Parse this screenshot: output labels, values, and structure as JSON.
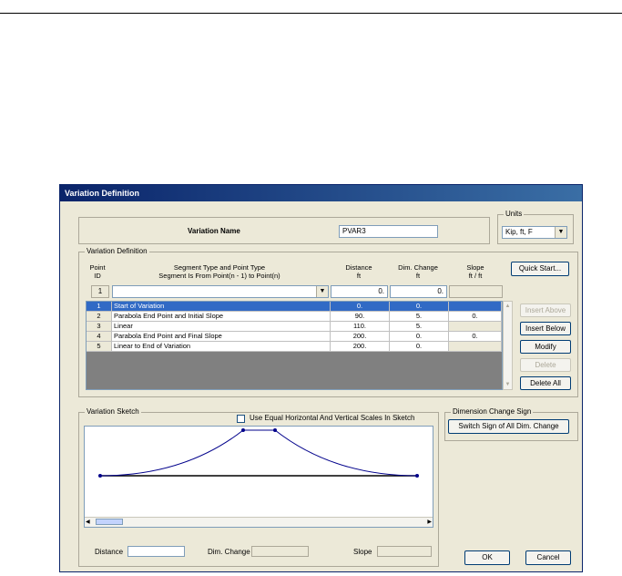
{
  "window": {
    "title": "Variation Definition"
  },
  "variation_name": {
    "label": "Variation Name",
    "value": "PVAR3"
  },
  "units": {
    "legend": "Units",
    "value": "Kip, ft, F"
  },
  "definition": {
    "legend": "Variation Definition",
    "headers": {
      "point": "Point",
      "id": "ID",
      "segment_type": "Segment Type and Point Type",
      "segment_from": "Segment Is From Point(n - 1) to Point(n)",
      "distance": "Distance",
      "distance_unit": "ft",
      "dim_change": "Dim. Change",
      "dim_change_unit": "ft",
      "slope": "Slope",
      "slope_unit": "ft / ft"
    },
    "edit_row": {
      "id": "1",
      "segment": "",
      "distance": "0.",
      "dim_change": "0.",
      "slope": ""
    },
    "rows": [
      {
        "id": "1",
        "segment": "Start of Variation",
        "distance": "0.",
        "dim_change": "0.",
        "slope": ""
      },
      {
        "id": "2",
        "segment": "Parabola End Point and Initial Slope",
        "distance": "90.",
        "dim_change": "5.",
        "slope": "0."
      },
      {
        "id": "3",
        "segment": "Linear",
        "distance": "110.",
        "dim_change": "5.",
        "slope": ""
      },
      {
        "id": "4",
        "segment": "Parabola End Point and Final Slope",
        "distance": "200.",
        "dim_change": "0.",
        "slope": "0."
      },
      {
        "id": "5",
        "segment": "Linear to End of Variation",
        "distance": "200.",
        "dim_change": "0.",
        "slope": ""
      }
    ],
    "buttons": {
      "quick_start": "Quick Start...",
      "insert_above": "Insert Above",
      "insert_below": "Insert Below",
      "modify": "Modify",
      "delete": "Delete",
      "delete_all": "Delete All"
    }
  },
  "sketch": {
    "legend": "Variation Sketch",
    "equal_scales_label": "Use Equal Horizontal And Vertical Scales In Sketch",
    "distance_label": "Distance",
    "dim_change_label": "Dim. Change",
    "slope_label": "Slope"
  },
  "dimension_sign": {
    "legend": "Dimension Change Sign",
    "button": "Switch Sign of All Dim. Change"
  },
  "footer": {
    "ok": "OK",
    "cancel": "Cancel"
  }
}
